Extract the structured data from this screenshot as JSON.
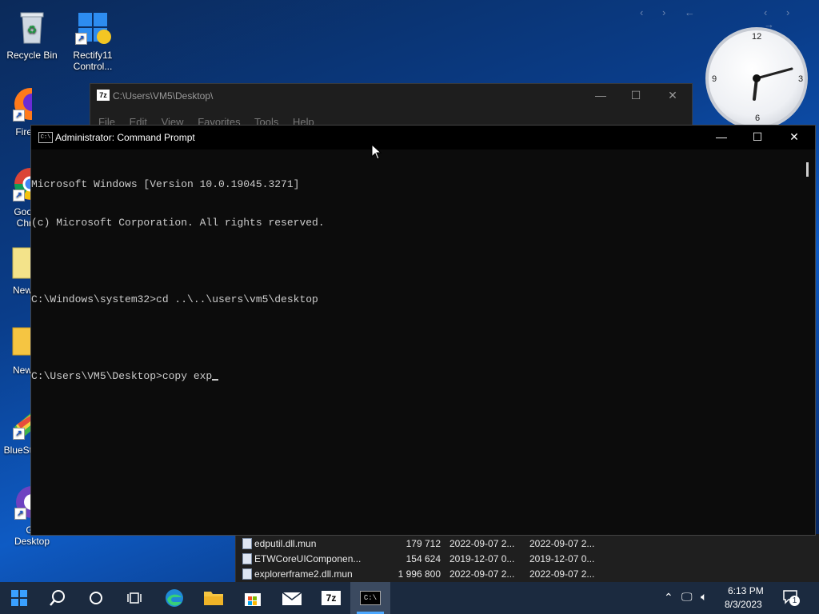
{
  "desktop": {
    "icons": [
      {
        "label": "Recycle Bin",
        "icon": "recycle-bin-icon"
      },
      {
        "label": "Rectify11 Control...",
        "icon": "rectify11-icon"
      },
      {
        "label": "Fire",
        "icon": "firefox-icon"
      },
      {
        "label": "Goo Chr",
        "icon": "chrome-icon"
      },
      {
        "label": "New",
        "icon": "folder-icon"
      },
      {
        "label": "New",
        "icon": "folder-icon"
      },
      {
        "label": "BlueSt",
        "icon": "bluestacks-icon"
      },
      {
        "label": "Git Desktop",
        "icon": "github-desktop-icon"
      }
    ]
  },
  "clock_gadget": {
    "n12": "12",
    "n3": "3",
    "n6": "6",
    "n9": "9"
  },
  "zip_window": {
    "title": "C:\\Users\\VM5\\Desktop\\",
    "menu": [
      "File",
      "Edit",
      "View",
      "Favorites",
      "Tools",
      "Help"
    ]
  },
  "file_list": {
    "rows": [
      {
        "name": "edputil.dll.mun",
        "size": "179 712",
        "modified": "2022-09-07 2...",
        "created": "2022-09-07 2..."
      },
      {
        "name": "ETWCoreUIComponen...",
        "size": "154 624",
        "modified": "2019-12-07 0...",
        "created": "2019-12-07 0..."
      },
      {
        "name": "explorerframe2.dll.mun",
        "size": "1 996 800",
        "modified": "2022-09-07 2...",
        "created": "2022-09-07 2..."
      }
    ]
  },
  "cmd": {
    "title": "Administrator: Command Prompt",
    "icon_label": "C:\\",
    "lines": [
      "Microsoft Windows [Version 10.0.19045.3271]",
      "(c) Microsoft Corporation. All rights reserved.",
      "",
      "C:\\Windows\\system32>cd ..\\..\\users\\vm5\\desktop",
      "",
      "C:\\Users\\VM5\\Desktop>copy exp"
    ]
  },
  "taskbar": {
    "items": [
      {
        "name": "start-button",
        "icon": "windows-logo-icon"
      },
      {
        "name": "search-button",
        "icon": "search-icon"
      },
      {
        "name": "cortana-button",
        "icon": "circle-icon"
      },
      {
        "name": "task-view-button",
        "icon": "task-view-icon"
      },
      {
        "name": "edge-button",
        "icon": "edge-icon"
      },
      {
        "name": "file-explorer-button",
        "icon": "folder-icon"
      },
      {
        "name": "store-button",
        "icon": "store-icon"
      },
      {
        "name": "mail-button",
        "icon": "mail-icon"
      },
      {
        "name": "7zip-button",
        "icon": "7zip-icon",
        "label": "7z"
      },
      {
        "name": "cmd-button",
        "icon": "cmd-icon",
        "label": "C:\\"
      }
    ],
    "time": "6:13 PM",
    "date": "8/3/2023",
    "notification_count": "1"
  },
  "colors": {
    "accent": "#0e5bc4",
    "taskbar": "#1b2a3f",
    "console_bg": "#0c0c0c",
    "console_text": "#cccccc"
  }
}
